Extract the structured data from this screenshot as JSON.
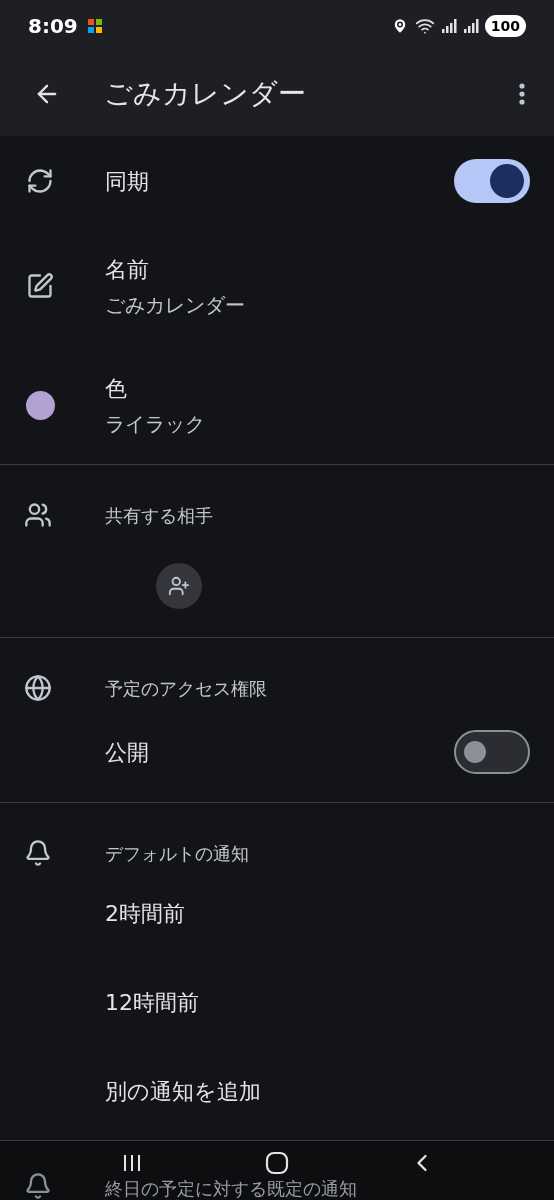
{
  "status_bar": {
    "time": "8:09",
    "battery": "100"
  },
  "app_bar": {
    "title": "ごみカレンダー"
  },
  "sync": {
    "label": "同期",
    "on": true
  },
  "name": {
    "label": "名前",
    "value": "ごみカレンダー"
  },
  "color": {
    "label": "色",
    "value": "ライラック",
    "color": "#b3a1d4"
  },
  "sharing": {
    "label": "共有する相手"
  },
  "access": {
    "label": "予定のアクセス権限",
    "public": {
      "label": "公開",
      "on": false
    }
  },
  "notifications": {
    "label": "デフォルトの通知",
    "items": [
      "2時間前",
      "12時間前"
    ],
    "add": "別の通知を追加"
  },
  "all_day": {
    "label": "終日の予定に対する既定の通知"
  }
}
